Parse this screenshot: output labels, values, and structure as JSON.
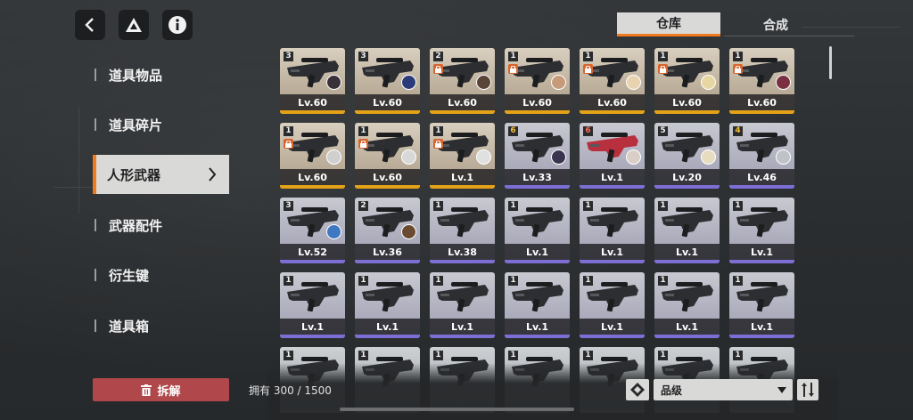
{
  "header": {
    "back_icon": "back-chevron-icon",
    "logo_icon": "triangle-logo-icon",
    "info_icon": "info-icon"
  },
  "tabs": [
    {
      "label": "仓库",
      "active": true
    },
    {
      "label": "合成",
      "active": false
    }
  ],
  "sidebar": {
    "items": [
      {
        "label": "道具物品",
        "active": false
      },
      {
        "label": "道具碎片",
        "active": false
      },
      {
        "label": "人形武器",
        "active": true
      },
      {
        "label": "武器配件",
        "active": false
      },
      {
        "label": "衍生键",
        "active": false
      },
      {
        "label": "道具箱",
        "active": false
      }
    ]
  },
  "weapons": [
    {
      "badge": "3",
      "level": "Lv.60",
      "rarity": "orange",
      "locked": false,
      "avatar": "#3a3038"
    },
    {
      "badge": "3",
      "level": "Lv.60",
      "rarity": "orange",
      "locked": false,
      "avatar": "#2b3b7a"
    },
    {
      "badge": "2",
      "level": "Lv.60",
      "rarity": "orange",
      "locked": true,
      "avatar": "#5a4438"
    },
    {
      "badge": "1",
      "level": "Lv.60",
      "rarity": "orange",
      "locked": true,
      "avatar": "#c79a7a"
    },
    {
      "badge": "1",
      "level": "Lv.60",
      "rarity": "orange",
      "locked": true,
      "avatar": "#e8d2b0"
    },
    {
      "badge": "1",
      "level": "Lv.60",
      "rarity": "orange",
      "locked": true,
      "avatar": "#e6d7a2"
    },
    {
      "badge": "1",
      "level": "Lv.60",
      "rarity": "orange",
      "locked": true,
      "avatar": "#7a3040"
    },
    {
      "badge": "1",
      "level": "Lv.60",
      "rarity": "orange",
      "locked": true,
      "avatar": "#cfcfcf"
    },
    {
      "badge": "1",
      "level": "Lv.60",
      "rarity": "orange",
      "locked": true,
      "avatar": "#d8d8d8"
    },
    {
      "badge": "1",
      "level": "Lv.1",
      "rarity": "orange",
      "locked": true,
      "avatar": "#e0e0e0"
    },
    {
      "badge": "6",
      "level": "Lv.33",
      "rarity": "purple",
      "locked": false,
      "avatar": "#3a3450",
      "badge_color": "gold"
    },
    {
      "badge": "6",
      "level": "Lv.1",
      "rarity": "purple",
      "locked": false,
      "avatar": "#d9cfc6",
      "badge_color": "red"
    },
    {
      "badge": "5",
      "level": "Lv.20",
      "rarity": "purple",
      "locked": false,
      "avatar": "#e8dcc0"
    },
    {
      "badge": "4",
      "level": "Lv.46",
      "rarity": "purple",
      "locked": false,
      "avatar": "#bfc2c6",
      "badge_color": "gold"
    },
    {
      "badge": "3",
      "level": "Lv.52",
      "rarity": "purple",
      "locked": false,
      "avatar": "#3d78c0"
    },
    {
      "badge": "2",
      "level": "Lv.36",
      "rarity": "purple",
      "locked": false,
      "avatar": "#6a4a30"
    },
    {
      "badge": "1",
      "level": "Lv.38",
      "rarity": "purple",
      "locked": false,
      "avatar": ""
    },
    {
      "badge": "1",
      "level": "Lv.1",
      "rarity": "purple",
      "locked": false,
      "avatar": ""
    },
    {
      "badge": "1",
      "level": "Lv.1",
      "rarity": "purple",
      "locked": false,
      "avatar": ""
    },
    {
      "badge": "1",
      "level": "Lv.1",
      "rarity": "purple",
      "locked": false,
      "avatar": ""
    },
    {
      "badge": "1",
      "level": "Lv.1",
      "rarity": "purple",
      "locked": false,
      "avatar": ""
    },
    {
      "badge": "1",
      "level": "Lv.1",
      "rarity": "purple",
      "locked": false,
      "avatar": ""
    },
    {
      "badge": "1",
      "level": "Lv.1",
      "rarity": "purple",
      "locked": false,
      "avatar": ""
    },
    {
      "badge": "1",
      "level": "Lv.1",
      "rarity": "purple",
      "locked": false,
      "avatar": ""
    },
    {
      "badge": "1",
      "level": "Lv.1",
      "rarity": "purple",
      "locked": false,
      "avatar": ""
    },
    {
      "badge": "1",
      "level": "Lv.1",
      "rarity": "purple",
      "locked": false,
      "avatar": ""
    },
    {
      "badge": "1",
      "level": "Lv.1",
      "rarity": "purple",
      "locked": false,
      "avatar": ""
    },
    {
      "badge": "1",
      "level": "Lv.1",
      "rarity": "purple",
      "locked": false,
      "avatar": ""
    },
    {
      "badge": "1",
      "level": "",
      "rarity": "white",
      "locked": false,
      "avatar": ""
    },
    {
      "badge": "1",
      "level": "",
      "rarity": "white",
      "locked": false,
      "avatar": ""
    },
    {
      "badge": "1",
      "level": "",
      "rarity": "white",
      "locked": false,
      "avatar": ""
    },
    {
      "badge": "1",
      "level": "",
      "rarity": "white",
      "locked": false,
      "avatar": ""
    },
    {
      "badge": "1",
      "level": "",
      "rarity": "white",
      "locked": false,
      "avatar": ""
    },
    {
      "badge": "1",
      "level": "",
      "rarity": "white",
      "locked": false,
      "avatar": ""
    },
    {
      "badge": "1",
      "level": "",
      "rarity": "white",
      "locked": false,
      "avatar": ""
    }
  ],
  "bottom": {
    "dismantle_label": "拆解",
    "owned_text": "拥有 300 / 1500",
    "sort_select": "品级"
  },
  "colors": {
    "accent": "#f07a1d",
    "dismantle": "#b0484b",
    "rarity_orange": "#e3a217",
    "rarity_purple": "#7d6ed6"
  }
}
